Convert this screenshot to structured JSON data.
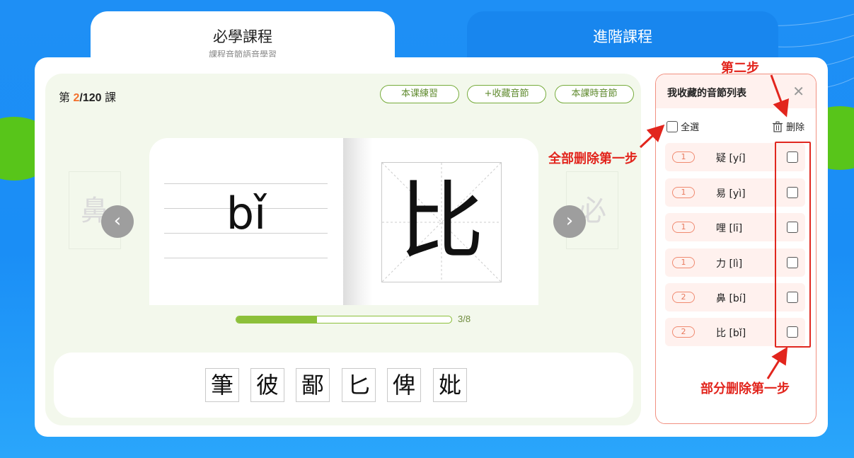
{
  "tabs": {
    "required_title": "必學課程",
    "required_subtitle": "課程音節語音學習",
    "advanced_title": "進階課程"
  },
  "lesson": {
    "prefix": "第",
    "current": "2",
    "total": "/120",
    "suffix": "課"
  },
  "buttons": {
    "practice": "本课練習",
    "favorite": "+收藏音節",
    "lesson_syllables": "本課時音節"
  },
  "flashcard": {
    "pinyin": "bǐ",
    "character": "比",
    "prev_ghost": "鼻",
    "next_ghost": "必",
    "prev_icon": "chevron-left-icon",
    "next_icon": "chevron-right-icon"
  },
  "progress": {
    "current": 3,
    "total": 8,
    "label": "3/8"
  },
  "related_chars": [
    "筆",
    "彼",
    "鄙",
    "匕",
    "俾",
    "妣"
  ],
  "favorites": {
    "title": "我收藏的音節列表",
    "close_icon": "close-icon",
    "select_all": "全選",
    "delete": "删除",
    "items": [
      {
        "badge": "1",
        "text": "疑 [yí]"
      },
      {
        "badge": "1",
        "text": "易 [yì]"
      },
      {
        "badge": "1",
        "text": "哩 [lī]"
      },
      {
        "badge": "1",
        "text": "力 [lì]"
      },
      {
        "badge": "2",
        "text": "鼻 [bí]"
      },
      {
        "badge": "2",
        "text": "比 [bǐ]"
      }
    ]
  },
  "annotations": {
    "step_two": "第二步",
    "delete_all_step_one": "全部删除第一步",
    "partial_delete_step_one": "部分删除第一步"
  },
  "colors": {
    "accent_orange": "#f3702c",
    "green": "#8cc03a",
    "annotation_red": "#e2251d",
    "background_blue": "#1e8ff5"
  }
}
